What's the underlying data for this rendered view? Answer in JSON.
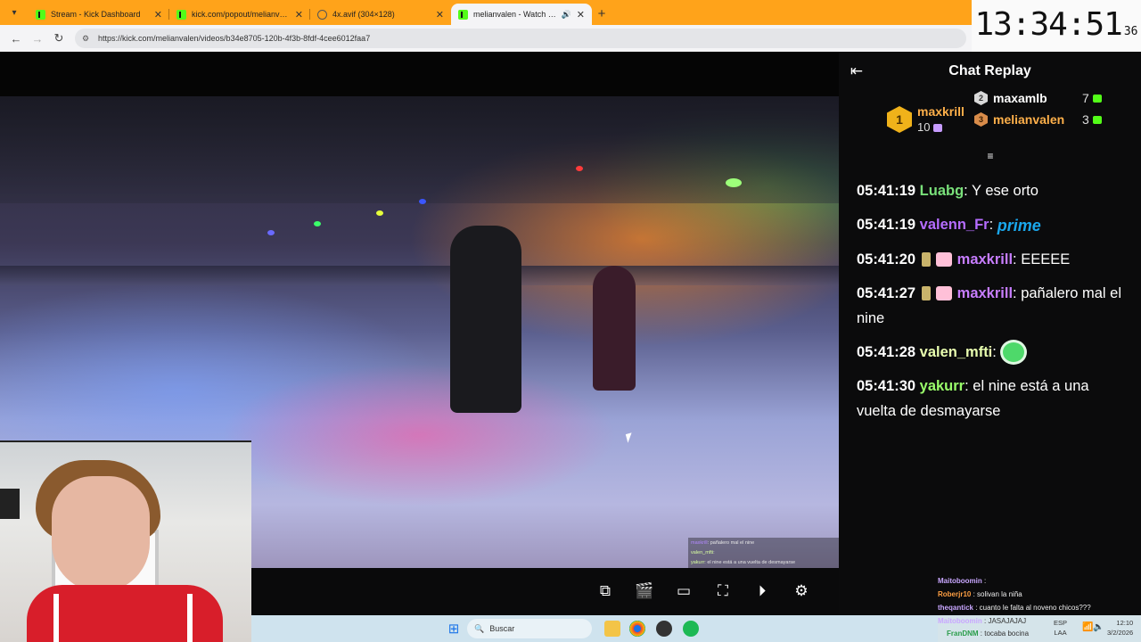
{
  "browser": {
    "tabs": [
      {
        "label": "Stream - Kick Dashboard",
        "icon": "kick-icon"
      },
      {
        "label": "kick.com/popout/melianvalen/chat",
        "icon": "kick-icon"
      },
      {
        "label": "4x.avif (304×128)",
        "icon": "globe-icon"
      },
      {
        "label": "melianvalen - Watch the VOD",
        "icon": "kick-icon",
        "active": true
      }
    ],
    "url": "https://kick.com/melianvalen/videos/b34e8705-120b-4f3b-8fdf-4cee6012faa7"
  },
  "clock": {
    "time": "13:34:51",
    "fraction": "36"
  },
  "video": {
    "overlay_chat": [
      {
        "user": "maxkrill",
        "text": ": pañalero mal el nine"
      },
      {
        "user": "valen_mfti",
        "text": ":"
      },
      {
        "user": "yakurr",
        "text": ": el nine está a una vuelta de desmayarse"
      }
    ]
  },
  "chat": {
    "title": "Chat Replay",
    "leaderboard": {
      "first": {
        "rank": "1",
        "name": "maxkrill",
        "count": "10"
      },
      "second": {
        "rank": "2",
        "name": "maxamlb",
        "count": "7"
      },
      "third": {
        "rank": "3",
        "name": "melianvalen",
        "count": "3"
      }
    },
    "messages": [
      {
        "ts": "05:41:19",
        "user": "Luabg",
        "color": "#79e07a",
        "text": " Y ese orto"
      },
      {
        "ts": "05:41:19",
        "user": "valenn_Fr",
        "color": "#b56cff",
        "text": "",
        "emote": "prime"
      },
      {
        "ts": "05:41:20",
        "user": "maxkrill",
        "color": "#c77dff",
        "text": " EEEEE"
      },
      {
        "ts": "05:41:27",
        "user": "maxkrill",
        "color": "#c77dff",
        "text": " pañalero mal el nine"
      },
      {
        "ts": "05:41:28",
        "user": "valen_mfti",
        "color": "#e9ffb0",
        "text": ""
      },
      {
        "ts": "05:41:30",
        "user": "yakurr",
        "color": "#9aff6b",
        "text": " el nine está a una vuelta de desmayarse"
      }
    ]
  },
  "stream_chat": [
    {
      "user": "Maitoboomin",
      "color": "#c9a7ff",
      "text": " :"
    },
    {
      "user": "Roberjr10",
      "color": "#ff9f43",
      "text": " : solivan la niña"
    },
    {
      "user": "theqantick",
      "color": "#c9a7ff",
      "text": " : cuanto le falta al noveno chicos???"
    },
    {
      "user": "Maitoboomin",
      "color": "#c9a7ff",
      "text": " : JASAJAJAJ"
    },
    {
      "user": "FranDNM",
      "color": "#6bff8a",
      "text": " : tocaba bocina"
    }
  ],
  "taskbar": {
    "search_label": "Buscar",
    "language": "ESP",
    "layout": "LAA",
    "time": "12:10",
    "date": "3/2/2026"
  },
  "colors": {
    "kick_green": "#53fc18",
    "tab_strip": "#ffa31a",
    "panel_bg": "#0b0b0c"
  }
}
